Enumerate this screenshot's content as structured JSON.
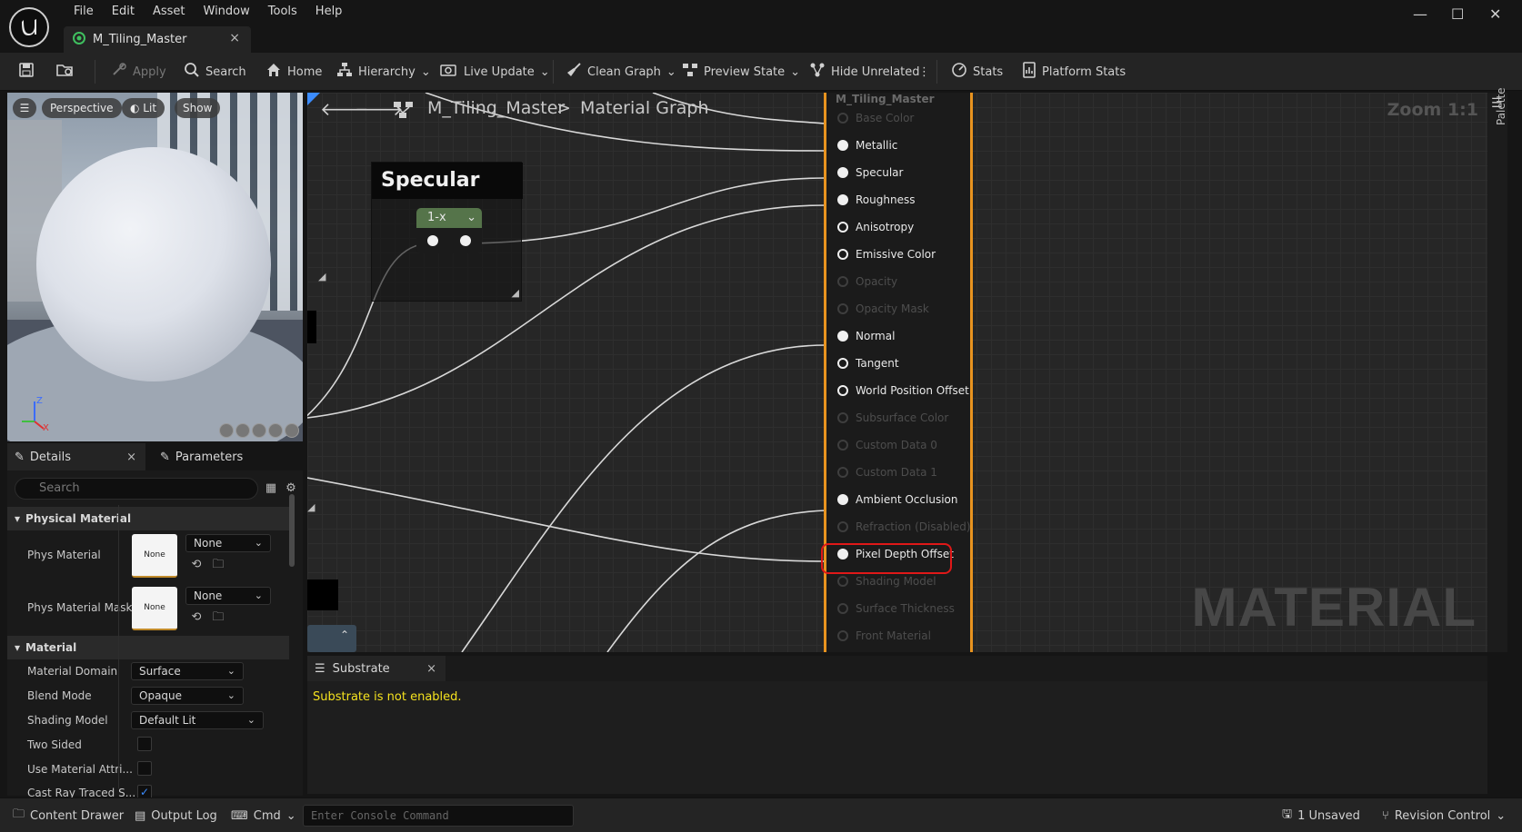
{
  "menu": [
    "File",
    "Edit",
    "Asset",
    "Window",
    "Tools",
    "Help"
  ],
  "document_tab": {
    "title": "M_Tiling_Master",
    "close": "×"
  },
  "window_controls": {
    "minimize": "—",
    "maximize": "☐",
    "close": "✕"
  },
  "toolbar": {
    "apply": "Apply",
    "search": "Search",
    "home": "Home",
    "hierarchy": "Hierarchy",
    "live_update": "Live Update",
    "clean_graph": "Clean Graph",
    "preview_state": "Preview State",
    "hide_unrelated": "Hide Unrelated",
    "stats": "Stats",
    "platform_stats": "Platform Stats"
  },
  "viewport": {
    "perspective": "Perspective",
    "lit": "Lit",
    "show": "Show"
  },
  "details": {
    "tab_details": "Details",
    "tab_parameters": "Parameters",
    "search_placeholder": "Search",
    "section_physical": "Physical Material",
    "phys_material_label": "Phys Material",
    "phys_material_thumb": "None",
    "phys_material_value": "None",
    "phys_material_mask_label": "Phys Material Mask",
    "phys_material_mask_thumb": "None",
    "phys_material_mask_value": "None",
    "section_material": "Material",
    "material_domain_label": "Material Domain",
    "material_domain_value": "Surface",
    "blend_mode_label": "Blend Mode",
    "blend_mode_value": "Opaque",
    "shading_model_label": "Shading Model",
    "shading_model_value": "Default Lit",
    "two_sided_label": "Two Sided",
    "use_material_attr_label": "Use Material Attri...",
    "cast_ray_label": "Cast Ray Traced S..."
  },
  "graph": {
    "breadcrumb_root": "M_Tiling_Master",
    "breadcrumb_sep": ">",
    "breadcrumb_leaf": "Material Graph",
    "zoom": "Zoom 1:1",
    "watermark": "MATERIAL",
    "palette": "Palette",
    "comment_title": "Specular",
    "oneminus_label": "1-x",
    "material_node_title": "M_Tiling_Master",
    "pins": [
      {
        "label": "Base Color",
        "state": "disabled"
      },
      {
        "label": "Metallic",
        "state": "connected"
      },
      {
        "label": "Specular",
        "state": "connected"
      },
      {
        "label": "Roughness",
        "state": "connected"
      },
      {
        "label": "Anisotropy",
        "state": "open"
      },
      {
        "label": "Emissive Color",
        "state": "open"
      },
      {
        "label": "Opacity",
        "state": "disabled"
      },
      {
        "label": "Opacity Mask",
        "state": "disabled"
      },
      {
        "label": "Normal",
        "state": "connected"
      },
      {
        "label": "Tangent",
        "state": "open"
      },
      {
        "label": "World Position Offset",
        "state": "open"
      },
      {
        "label": "Subsurface Color",
        "state": "disabled"
      },
      {
        "label": "Custom Data 0",
        "state": "disabled"
      },
      {
        "label": "Custom Data 1",
        "state": "disabled"
      },
      {
        "label": "Ambient Occlusion",
        "state": "connected"
      },
      {
        "label": "Refraction (Disabled)",
        "state": "disabled"
      },
      {
        "label": "Pixel Depth Offset",
        "state": "connected"
      },
      {
        "label": "Shading Model",
        "state": "disabled"
      },
      {
        "label": "Surface Thickness",
        "state": "disabled"
      },
      {
        "label": "Front Material",
        "state": "disabled"
      }
    ]
  },
  "substrate": {
    "tab": "Substrate",
    "message": "Substrate is not enabled.",
    "close": "×"
  },
  "statusbar": {
    "content_drawer": "Content Drawer",
    "output_log": "Output Log",
    "cmd": "Cmd",
    "console_placeholder": "Enter Console Command",
    "unsaved": "1 Unsaved",
    "revision_control": "Revision Control"
  },
  "colors": {
    "accent_orange": "#e8931f",
    "highlight_red": "#e01818",
    "message_yellow": "#f5e21f",
    "onex_green": "#55744a"
  }
}
